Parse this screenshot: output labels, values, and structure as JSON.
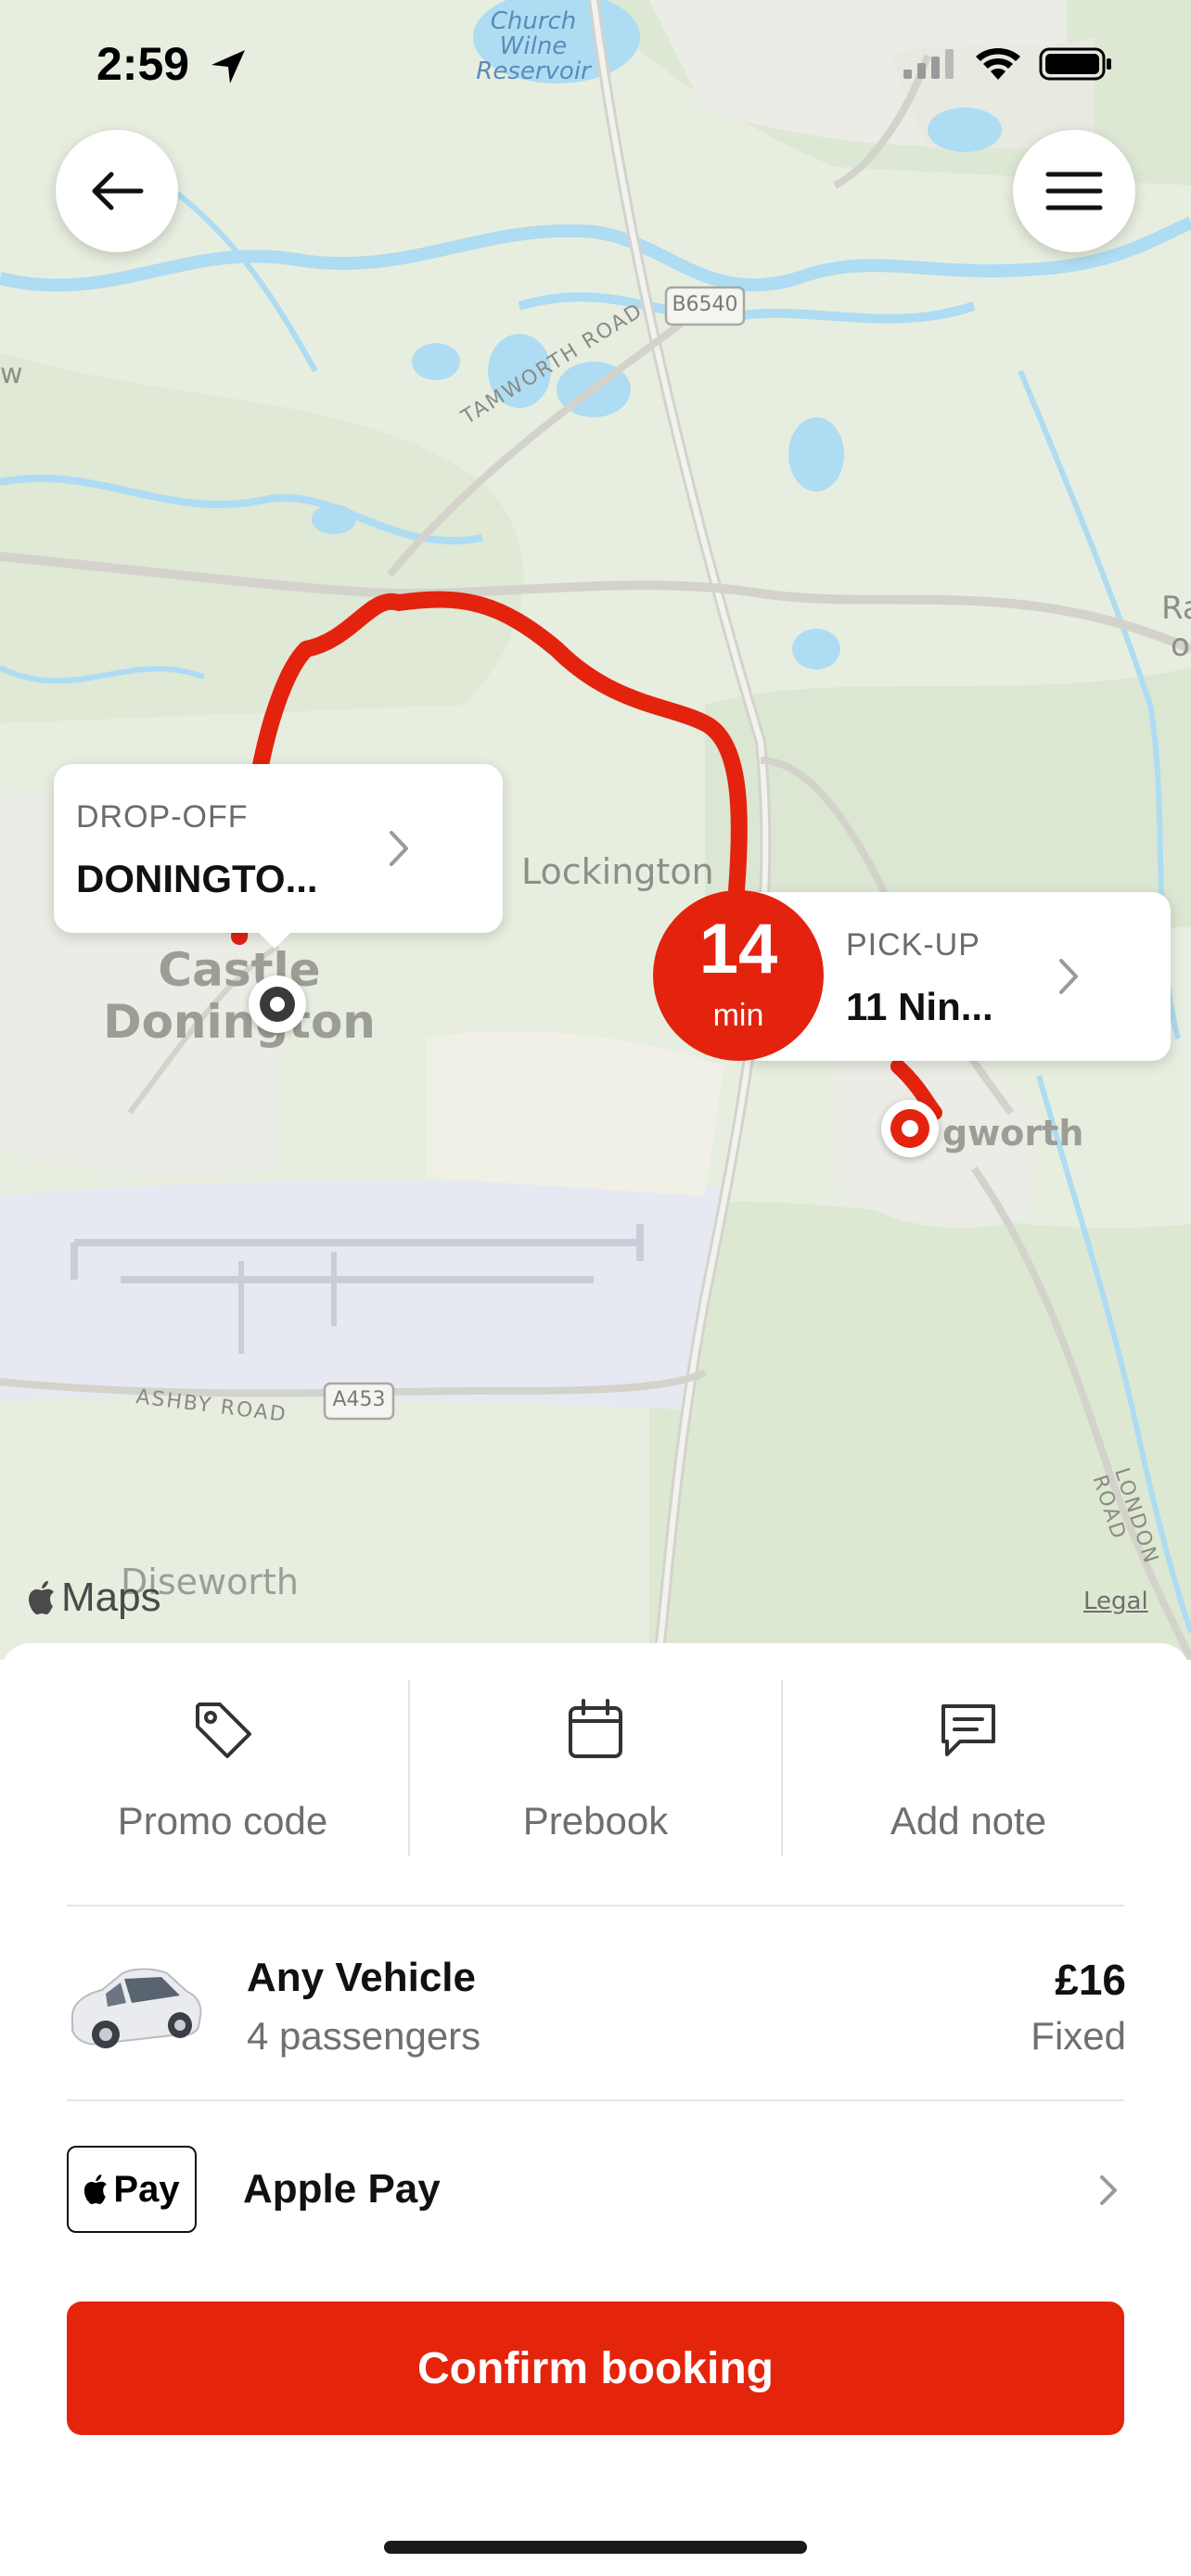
{
  "status_bar": {
    "time": "2:59"
  },
  "map": {
    "labels": {
      "reservoir": [
        "Church",
        "Wilne",
        "Reservoir"
      ],
      "road_b6540": "B6540",
      "tamworth_road": "TAMWORTH ROAD",
      "lockington": "Lockington",
      "castle_donington": [
        "Castle",
        "Donington"
      ],
      "hemington": "gworth",
      "ashby_road": "ASHBY ROAD",
      "road_a453": "A453",
      "diseworth": "Diseworth",
      "london_road": "LONDON ROAD",
      "edge_w": "w",
      "edge_r": "Ra",
      "edge_o": "o"
    },
    "dropoff": {
      "caption": "DROP-OFF",
      "value": "DONINGTO..."
    },
    "pickup": {
      "caption": "PICK-UP",
      "value": "11 Nin..."
    },
    "eta": {
      "number": "14",
      "unit": "min"
    },
    "attribution": "Maps",
    "legal": "Legal",
    "route_color": "#e3230e"
  },
  "options": [
    {
      "label": "Promo code",
      "icon": "tag-icon"
    },
    {
      "label": "Prebook",
      "icon": "calendar-icon"
    },
    {
      "label": "Add note",
      "icon": "note-icon"
    }
  ],
  "vehicle": {
    "title": "Any Vehicle",
    "passengers": "4 passengers",
    "price": "£16",
    "price_type": "Fixed"
  },
  "payment": {
    "badge": "Pay",
    "method": "Apple Pay"
  },
  "confirm_label": "Confirm booking",
  "colors": {
    "accent": "#e5240c",
    "map_base": "#e7eee0",
    "water": "#aedcf2"
  }
}
